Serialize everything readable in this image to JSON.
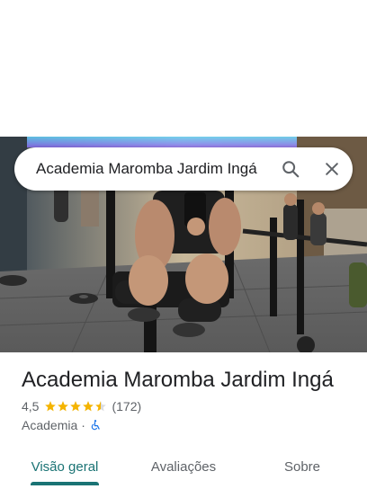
{
  "search": {
    "query": "Academia Maromba Jardim Ingá"
  },
  "place": {
    "title": "Academia Maromba Jardim Ingá",
    "rating": "4,5",
    "review_count": "(172)",
    "stars_filled": 4.5,
    "category": "Academia",
    "separator": "·",
    "accessibility_icon": "wheelchair-icon"
  },
  "tabs": [
    {
      "label": "Visão geral",
      "active": true
    },
    {
      "label": "Avaliações",
      "active": false
    },
    {
      "label": "Sobre",
      "active": false
    }
  ],
  "colors": {
    "accent": "#1a7374",
    "star": "#f4b400",
    "accessible": "#1a73e8"
  }
}
